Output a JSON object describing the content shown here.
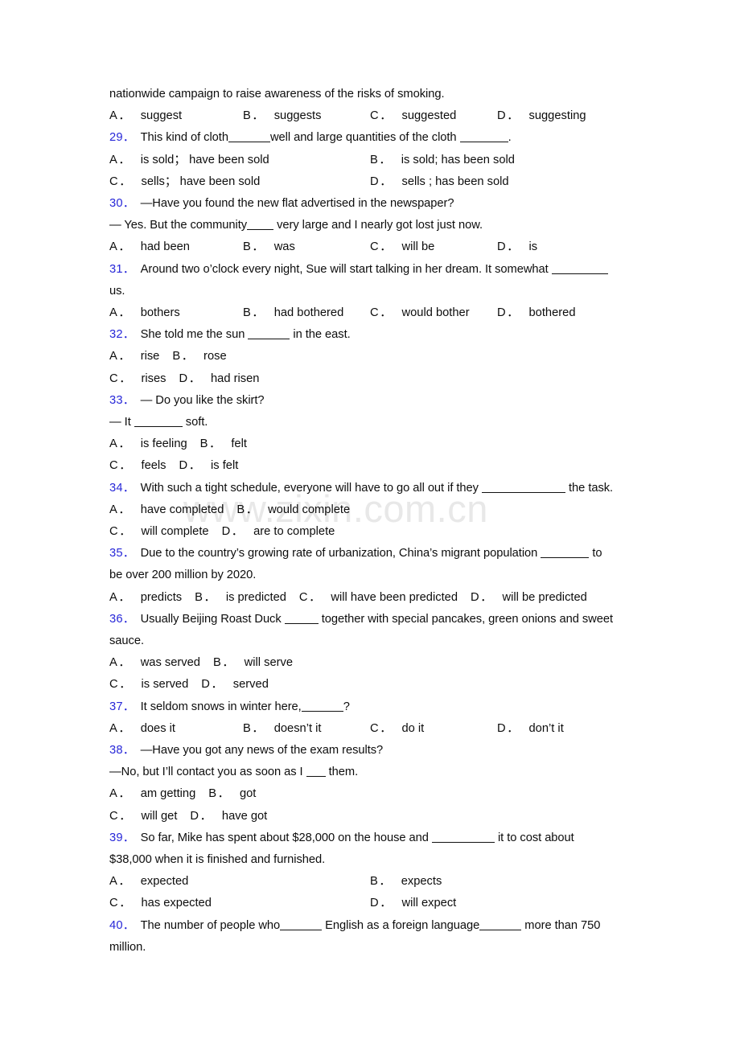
{
  "document": {
    "watermark": "www.zixin.com.cn",
    "accent_color": "#2727d8",
    "text_color": "#0d0d0d",
    "background_color": "#ffffff"
  },
  "carryover": {
    "stem_tail": "nationwide campaign to raise awareness of the risks of smoking.",
    "options": [
      {
        "label": "A．",
        "text": "suggest"
      },
      {
        "label": "B．",
        "text": "suggests"
      },
      {
        "label": "C．",
        "text": "suggested"
      },
      {
        "label": "D．",
        "text": "suggesting"
      }
    ]
  },
  "questions": [
    {
      "number": "29．",
      "stem_pre": "This kind of cloth",
      "stem_mid": "well and large quantities of the cloth ",
      "stem_post": ".",
      "options": [
        {
          "label": "A．",
          "text": "is sold；  have been sold"
        },
        {
          "label": "B．",
          "text": "is sold; has been sold"
        },
        {
          "label": "C．",
          "text": "sells；  have been sold"
        },
        {
          "label": "D．",
          "text": "sells ; has been sold"
        }
      ]
    },
    {
      "number": "30．",
      "stem_line1": "—Have you found the new flat advertised in the newspaper?",
      "stem_line2_pre": "— Yes. But the community",
      "stem_line2_post": " very large and I nearly got lost just now.",
      "options": [
        {
          "label": "A．",
          "text": "had been"
        },
        {
          "label": "B．",
          "text": "was"
        },
        {
          "label": "C．",
          "text": "will be"
        },
        {
          "label": "D．",
          "text": "is"
        }
      ]
    },
    {
      "number": "31．",
      "stem_line1": "Around two o’clock every night, Sue will start talking in her dream. It somewhat ",
      "stem_line2": "us.",
      "options": [
        {
          "label": "A．",
          "text": "bothers"
        },
        {
          "label": "B．",
          "text": "had bothered"
        },
        {
          "label": "C．",
          "text": "would bother"
        },
        {
          "label": "D．",
          "text": "bothered"
        }
      ]
    },
    {
      "number": "32．",
      "stem_pre": "She told me the sun ",
      "stem_post": " in the east.",
      "options": [
        {
          "label": "A．",
          "text": "rise"
        },
        {
          "label": "B．",
          "text": "rose"
        },
        {
          "label": "C．",
          "text": "rises"
        },
        {
          "label": "D．",
          "text": "had risen"
        }
      ]
    },
    {
      "number": "33．",
      "stem_line1": "— Do you like the skirt?",
      "stem_line2_pre": "— It ",
      "stem_line2_post": " soft.",
      "options": [
        {
          "label": "A．",
          "text": "is feeling"
        },
        {
          "label": "B．",
          "text": "felt"
        },
        {
          "label": "C．",
          "text": "feels"
        },
        {
          "label": "D．",
          "text": "is felt"
        }
      ]
    },
    {
      "number": "34．",
      "stem_pre": "With such a tight schedule, everyone will have to go all out if they ",
      "stem_post": " the task.",
      "options": [
        {
          "label": "A．",
          "text": "have completed"
        },
        {
          "label": "B．",
          "text": "would complete"
        },
        {
          "label": "C．",
          "text": "will complete"
        },
        {
          "label": "D．",
          "text": "are to complete"
        }
      ]
    },
    {
      "number": "35．",
      "stem_line1": "Due to the country’s growing rate of urbanization, China’s migrant population ",
      "stem_line1_tail": " to",
      "stem_line2": "be over 200 million by 2020.",
      "options": [
        {
          "label": "A．",
          "text": "predicts"
        },
        {
          "label": "B．",
          "text": "is predicted"
        },
        {
          "label": "C．",
          "text": "will have been predicted"
        },
        {
          "label": "D．",
          "text": "will be predicted"
        }
      ]
    },
    {
      "number": "36．",
      "stem_line1": "Usually Beijing Roast Duck ",
      "stem_line1_tail": " together with special pancakes, green onions and sweet",
      "stem_line2": "sauce.",
      "options": [
        {
          "label": "A．",
          "text": "was served"
        },
        {
          "label": "B．",
          "text": "will serve"
        },
        {
          "label": "C．",
          "text": "is served"
        },
        {
          "label": "D．",
          "text": "served"
        }
      ]
    },
    {
      "number": "37．",
      "stem_pre": "It seldom snows in winter here,",
      "stem_post": "?",
      "options": [
        {
          "label": "A．",
          "text": "does it"
        },
        {
          "label": "B．",
          "text": "doesn’t it"
        },
        {
          "label": "C．",
          "text": "do it"
        },
        {
          "label": "D．",
          "text": "don’t it"
        }
      ]
    },
    {
      "number": "38．",
      "stem_line1": "—Have you got any news of the exam results?",
      "stem_line2_pre": "—No, but I’ll contact you as soon as I ",
      "stem_line2_post": " them.",
      "options": [
        {
          "label": "A．",
          "text": "am getting"
        },
        {
          "label": "B．",
          "text": "got"
        },
        {
          "label": "C．",
          "text": "will get"
        },
        {
          "label": "D．",
          "text": "have got"
        }
      ]
    },
    {
      "number": "39．",
      "stem_line1": "So far, Mike has spent about $28,000 on the house and ",
      "stem_line1_tail": " it to cost about",
      "stem_line2": "$38,000 when it is finished and furnished.",
      "options": [
        {
          "label": "A．",
          "text": "expected"
        },
        {
          "label": "B．",
          "text": "expects"
        },
        {
          "label": "C．",
          "text": "has expected"
        },
        {
          "label": "D．",
          "text": "will expect"
        }
      ]
    },
    {
      "number": "40．",
      "stem_line1_pre": "The number of people who",
      "stem_line1_mid": " English as a foreign language",
      "stem_line1_tail": " more than 750",
      "stem_line2": "million."
    }
  ]
}
